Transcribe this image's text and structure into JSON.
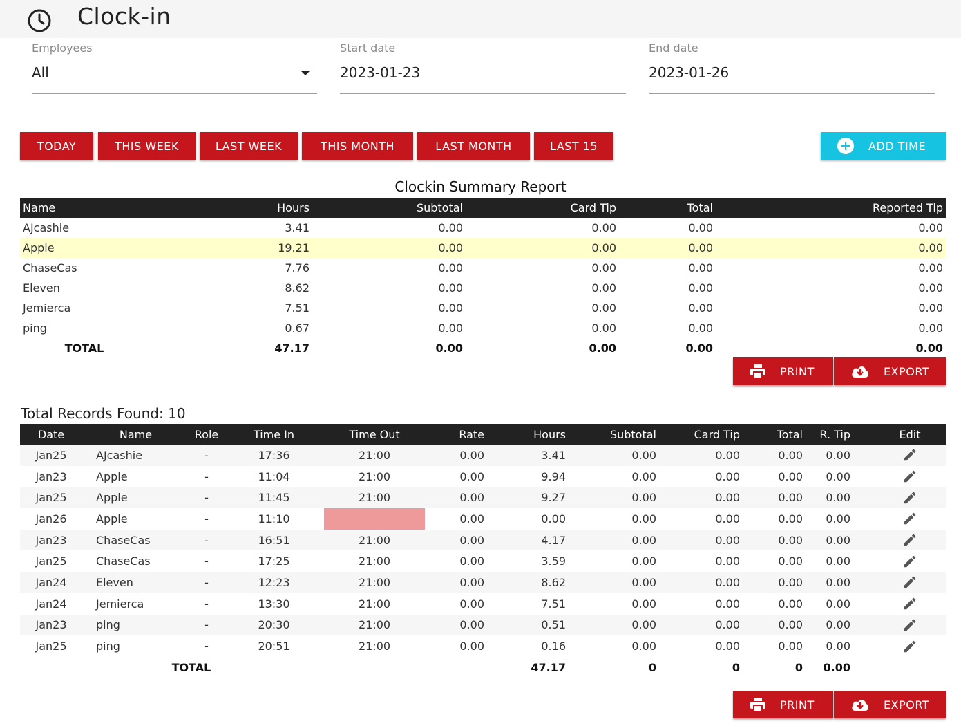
{
  "header": {
    "title": "Clock-in",
    "icon": "clock-icon"
  },
  "filters": {
    "employees": {
      "label": "Employees",
      "value": "All"
    },
    "start_date": {
      "label": "Start date",
      "value": "2023-01-23"
    },
    "end_date": {
      "label": "End date",
      "value": "2023-01-26"
    }
  },
  "quick_ranges": [
    "TODAY",
    "THIS WEEK",
    "LAST WEEK",
    "THIS MONTH",
    "LAST MONTH",
    "LAST 15"
  ],
  "add_time_label": "ADD TIME",
  "summary": {
    "title": "Clockin Summary Report",
    "columns": [
      "Name",
      "Hours",
      "Subtotal",
      "Card Tip",
      "Total",
      "Reported Tip"
    ],
    "rows": [
      [
        "AJcashie",
        "3.41",
        "0.00",
        "0.00",
        "0.00",
        "0.00"
      ],
      [
        "Apple",
        "19.21",
        "0.00",
        "0.00",
        "0.00",
        "0.00"
      ],
      [
        "ChaseCas",
        "7.76",
        "0.00",
        "0.00",
        "0.00",
        "0.00"
      ],
      [
        "Eleven",
        "8.62",
        "0.00",
        "0.00",
        "0.00",
        "0.00"
      ],
      [
        "Jemierca",
        "7.51",
        "0.00",
        "0.00",
        "0.00",
        "0.00"
      ],
      [
        "ping",
        "0.67",
        "0.00",
        "0.00",
        "0.00",
        "0.00"
      ]
    ],
    "total": [
      "TOTAL",
      "47.17",
      "0.00",
      "0.00",
      "0.00",
      "0.00"
    ],
    "highlight_color": "#ffffcc"
  },
  "actions": {
    "print_label": "PRINT",
    "export_label": "EXPORT"
  },
  "records": {
    "label": "Total Records Found: 10",
    "columns": [
      "Date",
      "Name",
      "Role",
      "Time In",
      "Time Out",
      "Rate",
      "Hours",
      "Subtotal",
      "Card Tip",
      "Total",
      "R. Tip",
      "Edit"
    ],
    "rows": [
      [
        "Jan25",
        "AJcashie",
        "-",
        "17:36",
        "21:00",
        "0.00",
        "3.41",
        "0.00",
        "0.00",
        "0.00",
        "0.00"
      ],
      [
        "Jan23",
        "Apple",
        "-",
        "11:04",
        "21:00",
        "0.00",
        "9.94",
        "0.00",
        "0.00",
        "0.00",
        "0.00"
      ],
      [
        "Jan25",
        "Apple",
        "-",
        "11:45",
        "21:00",
        "0.00",
        "9.27",
        "0.00",
        "0.00",
        "0.00",
        "0.00"
      ],
      [
        "Jan26",
        "Apple",
        "-",
        "11:10",
        "",
        "0.00",
        "0.00",
        "0.00",
        "0.00",
        "0.00",
        "0.00"
      ],
      [
        "Jan23",
        "ChaseCas",
        "-",
        "16:51",
        "21:00",
        "0.00",
        "4.17",
        "0.00",
        "0.00",
        "0.00",
        "0.00"
      ],
      [
        "Jan25",
        "ChaseCas",
        "-",
        "17:25",
        "21:00",
        "0.00",
        "3.59",
        "0.00",
        "0.00",
        "0.00",
        "0.00"
      ],
      [
        "Jan24",
        "Eleven",
        "-",
        "12:23",
        "21:00",
        "0.00",
        "8.62",
        "0.00",
        "0.00",
        "0.00",
        "0.00"
      ],
      [
        "Jan24",
        "Jemierca",
        "-",
        "13:30",
        "21:00",
        "0.00",
        "7.51",
        "0.00",
        "0.00",
        "0.00",
        "0.00"
      ],
      [
        "Jan23",
        "ping",
        "-",
        "20:30",
        "21:00",
        "0.00",
        "0.51",
        "0.00",
        "0.00",
        "0.00",
        "0.00"
      ],
      [
        "Jan25",
        "ping",
        "-",
        "20:51",
        "21:00",
        "0.00",
        "0.16",
        "0.00",
        "0.00",
        "0.00",
        "0.00"
      ]
    ],
    "total": {
      "label": "TOTAL",
      "hours": "47.17",
      "subtotal": "0",
      "card_tip": "0",
      "total": "0",
      "r_tip": "0.00"
    },
    "missing_color": "#ef9a9a"
  },
  "colors": {
    "primary_red": "#c4161c",
    "accent_cyan": "#16c3e0",
    "header_dark": "#222222"
  }
}
